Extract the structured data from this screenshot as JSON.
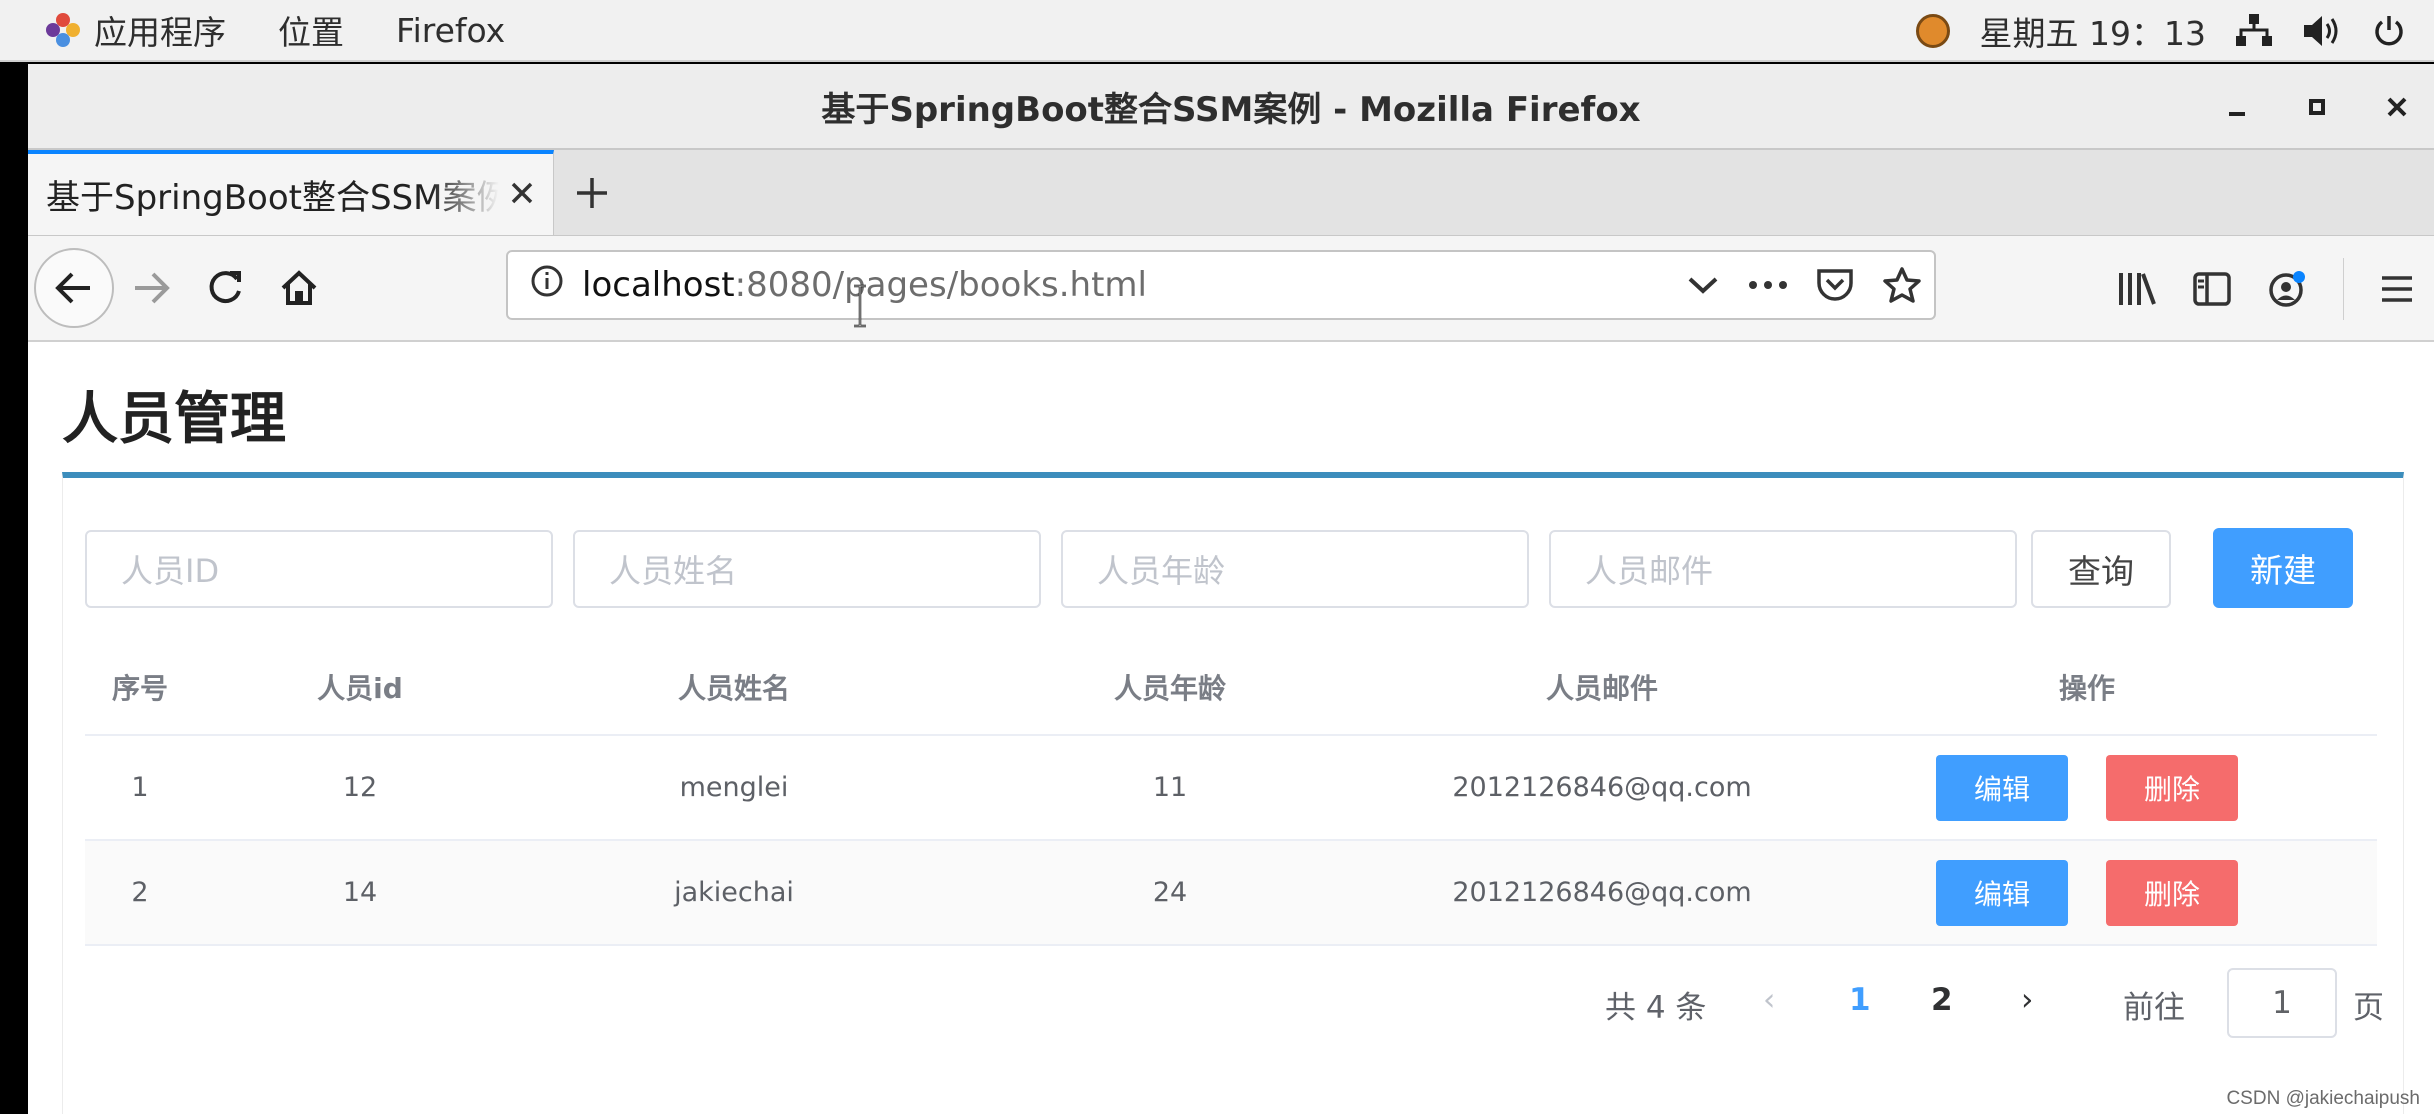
{
  "system_bar": {
    "apps_label": "应用程序",
    "places_label": "位置",
    "firefox_label": "Firefox",
    "clock": "星期五 19：13"
  },
  "window": {
    "title": "基于SpringBoot整合SSM案例 - Mozilla Firefox"
  },
  "browser": {
    "tab_title": "基于SpringBoot整合SSM案例",
    "url_host": "localhost",
    "url_rest": ":8080/pages/books.html"
  },
  "page": {
    "title": "人员管理",
    "filters": {
      "id_placeholder": "人员ID",
      "name_placeholder": "人员姓名",
      "age_placeholder": "人员年龄",
      "email_placeholder": "人员邮件"
    },
    "query_label": "查询",
    "new_label": "新建",
    "table": {
      "headers": [
        "序号",
        "人员id",
        "人员姓名",
        "人员年龄",
        "人员邮件",
        "操作"
      ],
      "rows": [
        {
          "index": "1",
          "id": "12",
          "name": "menglei",
          "age": "11",
          "email": "2012126846@qq.com"
        },
        {
          "index": "2",
          "id": "14",
          "name": "jakiechai",
          "age": "24",
          "email": "2012126846@qq.com"
        }
      ],
      "edit_label": "编辑",
      "delete_label": "删除"
    },
    "pagination": {
      "total_text": "共 4 条",
      "prev": "‹",
      "pages": [
        "1",
        "2"
      ],
      "next": "›",
      "goto_label": "前往",
      "goto_value": "1",
      "goto_unit": "页"
    },
    "watermark": "CSDN @jakiechaipush"
  },
  "colors": {
    "primary": "#409eff",
    "danger": "#f56c6c",
    "box_accent": "#3c8dbc",
    "firefox_tab_accent": "#0a84ff"
  }
}
